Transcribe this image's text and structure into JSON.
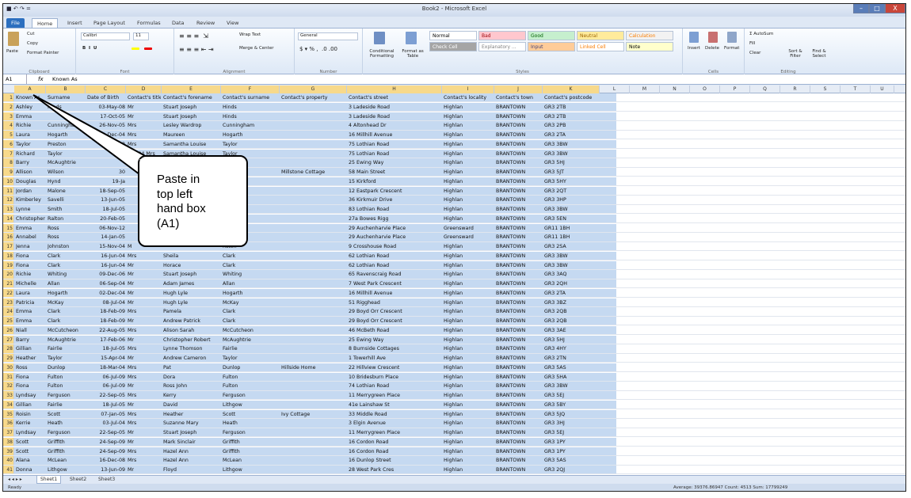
{
  "window": {
    "title": "Book2 - Microsoft Excel",
    "minimize": "–",
    "restore": "□",
    "close": "X"
  },
  "qat": "■ ↶ ↷ =",
  "tabs": [
    "File",
    "Home",
    "Insert",
    "Page Layout",
    "Formulas",
    "Data",
    "Review",
    "View"
  ],
  "ribbon": {
    "clipboard": {
      "paste": "Paste",
      "cut": "Cut",
      "copy": "Copy",
      "format_painter": "Format Painter",
      "label": "Clipboard"
    },
    "font": {
      "name": "Calibri",
      "size": "11",
      "label": "Font"
    },
    "alignment": {
      "wrap": "Wrap Text",
      "merge": "Merge & Center",
      "label": "Alignment"
    },
    "number": {
      "format": "General",
      "label": "Number"
    },
    "styles": {
      "conditional": "Conditional Formatting",
      "format_table": "Format as Table",
      "label": "Styles",
      "cells": [
        {
          "t": "Normal",
          "bg": "#ffffff",
          "c": "#000"
        },
        {
          "t": "Bad",
          "bg": "#ffc7ce",
          "c": "#9c0006"
        },
        {
          "t": "Good",
          "bg": "#c6efce",
          "c": "#006100"
        },
        {
          "t": "Neutral",
          "bg": "#ffeb9c",
          "c": "#9c6500"
        },
        {
          "t": "Calculation",
          "bg": "#f2f2f2",
          "c": "#fa7d00"
        },
        {
          "t": "Check Cell",
          "bg": "#a5a5a5",
          "c": "#ffffff"
        },
        {
          "t": "Explanatory ...",
          "bg": "#ffffff",
          "c": "#7f7f7f"
        },
        {
          "t": "Input",
          "bg": "#ffcc99",
          "c": "#3f3f76"
        },
        {
          "t": "Linked Cell",
          "bg": "#ffffff",
          "c": "#fa7d00"
        },
        {
          "t": "Note",
          "bg": "#ffffcc",
          "c": "#000"
        }
      ]
    },
    "cells": {
      "insert": "Insert",
      "delete": "Delete",
      "format": "Format",
      "label": "Cells"
    },
    "editing": {
      "autosum": "AutoSum",
      "fill": "Fill",
      "clear": "Clear",
      "sort": "Sort & Filter",
      "find": "Find & Select",
      "label": "Editing"
    }
  },
  "formula_bar": {
    "name_box": "A1",
    "fx": "fx",
    "value": "Known As"
  },
  "columns": [
    {
      "l": "A",
      "w": 40
    },
    {
      "l": "B",
      "w": 50
    },
    {
      "l": "C",
      "w": 51
    },
    {
      "l": "D",
      "w": 45
    },
    {
      "l": "E",
      "w": 75
    },
    {
      "l": "F",
      "w": 74
    },
    {
      "l": "G",
      "w": 85
    },
    {
      "l": "H",
      "w": 120
    },
    {
      "l": "I",
      "w": 66
    },
    {
      "l": "J",
      "w": 61
    },
    {
      "l": "K",
      "w": 72
    },
    {
      "l": "L",
      "w": 38
    },
    {
      "l": "M",
      "w": 38
    },
    {
      "l": "N",
      "w": 38
    },
    {
      "l": "O",
      "w": 38
    },
    {
      "l": "P",
      "w": 38
    },
    {
      "l": "Q",
      "w": 38
    },
    {
      "l": "R",
      "w": 38
    },
    {
      "l": "S",
      "w": 38
    },
    {
      "l": "T",
      "w": 38
    },
    {
      "l": "U",
      "w": 30
    }
  ],
  "rows": [
    [
      "Known As",
      "Surname",
      "Date of Birth",
      "Contact's title",
      "Contact's forename",
      "Contact's surname",
      "Contact's property",
      "Contact's street",
      "Contact's locality",
      "Contact's town",
      "Contact's postcode"
    ],
    [
      "Ashley",
      "Hinds",
      "03-May-08",
      "Mr",
      "Stuart Joseph",
      "Hinds",
      "",
      "3 Ladeside Road",
      "Highlan",
      "BRANTOWN",
      "GR3 2TB"
    ],
    [
      "Emma",
      "",
      "17-Oct-05",
      "Mr",
      "Stuart Joseph",
      "Hinds",
      "",
      "3 Ladeside Road",
      "Highlan",
      "BRANTOWN",
      "GR3 2TB"
    ],
    [
      "Richie",
      "Cunningham",
      "26-Nov-05",
      "Mrs",
      "Lesley Wardrop",
      "Cunningham",
      "",
      "4 Altonhead Dr",
      "Highlan",
      "BRANTOWN",
      "GR3 2PB"
    ],
    [
      "Laura",
      "Hogarth",
      "02-Dec-04",
      "Mrs",
      "Maureen",
      "Hogarth",
      "",
      "16 Millhill Avenue",
      "Highlan",
      "BRANTOWN",
      "GR3 2TA"
    ],
    [
      "Taylor",
      "Preston",
      "08-Apr-12",
      "Mrs",
      "Samantha Louise",
      "Taylor",
      "",
      "75 Lothian Road",
      "Highlan",
      "BRANTOWN",
      "GR3 3BW"
    ],
    [
      "Richard",
      "Taylor",
      "",
      "Feb-04 Mrs",
      "Samantha Louise",
      "Taylor",
      "",
      "75 Lothian Road",
      "Highlan",
      "BRANTOWN",
      "GR3 3BW"
    ],
    [
      "Barry",
      "McAughtrie",
      "",
      "",
      "",
      "aughtrie",
      "",
      "25 Ewing Way",
      "Highlan",
      "BRANTOWN",
      "GR3 5HJ"
    ],
    [
      "Allison",
      "Wilson",
      "30",
      "",
      "",
      "on",
      "Millstone Cottage",
      "58 Main Street",
      "Highlan",
      "BRANTOWN",
      "GR3 5JT"
    ],
    [
      "Douglas",
      "Hynd",
      "19-Ja",
      "",
      "",
      "",
      "",
      "15 Kirkford",
      "Highlan",
      "BRANTOWN",
      "GR3 5HY"
    ],
    [
      "Jordan",
      "Malone",
      "18-Sep-05",
      "",
      "",
      "n",
      "",
      "12 Eastpark Crescent",
      "Highlan",
      "BRANTOWN",
      "GR3 2QT"
    ],
    [
      "Kimberley",
      "Savelli",
      "13-Jun-05",
      "",
      "",
      "lli",
      "",
      "36 Kirkmuir Drive",
      "Highlan",
      "BRANTOWN",
      "GR3 3HP"
    ],
    [
      "Lynne",
      "Smith",
      "18-Jul-05",
      "",
      "",
      "lli",
      "",
      "83 Lothian Road",
      "Highlan",
      "BRANTOWN",
      "GR3 3BW"
    ],
    [
      "Christopher",
      "Ralton",
      "20-Feb-05",
      "",
      "",
      "n",
      "",
      "27a Bowes Rigg",
      "Highlan",
      "BRANTOWN",
      "GR3 5EN"
    ],
    [
      "Emma",
      "Ross",
      "06-Nov-12",
      "",
      "",
      "",
      "",
      "29 Auchenharvie Place",
      "Greensward",
      "BRANTOWN",
      "GR11 1BH"
    ],
    [
      "Annabel",
      "Ross",
      "14-Jan-05",
      "",
      "",
      "",
      "",
      "29 Auchenharvie Place",
      "Greensward",
      "BRANTOWN",
      "GR11 1BH"
    ],
    [
      "Jenna",
      "Johnston",
      "15-Nov-04",
      "M",
      "",
      "nston",
      "",
      "9 Crosshouse Road",
      "Highlan",
      "BRANTOWN",
      "GR3 2SA"
    ],
    [
      "Fiona",
      "Clark",
      "16-Jun-04",
      "Mrs",
      "Sheila",
      "Clark",
      "",
      "62 Lothian Road",
      "Highlan",
      "BRANTOWN",
      "GR3 3BW"
    ],
    [
      "Fiona",
      "Clark",
      "16-Jun-04",
      "Mr",
      "Horace",
      "Clark",
      "",
      "62 Lothian Road",
      "Highlan",
      "BRANTOWN",
      "GR3 3BW"
    ],
    [
      "Richie",
      "Whiting",
      "09-Dec-06",
      "Mr",
      "Stuart Joseph",
      "Whiting",
      "",
      "65 Ravenscraig Road",
      "Highlan",
      "BRANTOWN",
      "GR3 3AQ"
    ],
    [
      "Michelle",
      "Allan",
      "06-Sep-04",
      "Mr",
      "Adam James",
      "Allan",
      "",
      "7 West Park Crescent",
      "Highlan",
      "BRANTOWN",
      "GR3 2QH"
    ],
    [
      "Laura",
      "Hogarth",
      "02-Dec-04",
      "Mr",
      "Hugh Lyle",
      "Hogarth",
      "",
      "16 Millhill Avenue",
      "Highlan",
      "BRANTOWN",
      "GR3 2TA"
    ],
    [
      "Patricia",
      "McKay",
      "08-Jul-04",
      "Mr",
      "Hugh Lyle",
      "McKay",
      "",
      "51 Rigghead",
      "Highlan",
      "BRANTOWN",
      "GR3 3BZ"
    ],
    [
      "Emma",
      "Clark",
      "18-Feb-09",
      "Mrs",
      "Pamela",
      "Clark",
      "",
      "29 Boyd Orr Crescent",
      "Highlan",
      "BRANTOWN",
      "GR3 2QB"
    ],
    [
      "Emma",
      "Clark",
      "18-Feb-09",
      "Mr",
      "Andrew Patrick",
      "Clark",
      "",
      "29 Boyd Orr Crescent",
      "Highlan",
      "BRANTOWN",
      "GR3 2QB"
    ],
    [
      "Niall",
      "McCutcheon",
      "22-Aug-05",
      "Mrs",
      "Alison Sarah",
      "McCutcheon",
      "",
      "46 McBeth Road",
      "Highlan",
      "BRANTOWN",
      "GR3 3AE"
    ],
    [
      "Barry",
      "McAughtrie",
      "17-Feb-06",
      "Mr",
      "Christopher Robert",
      "McAughtrie",
      "",
      "25 Ewing Way",
      "Highlan",
      "BRANTOWN",
      "GR3 5HJ"
    ],
    [
      "Gillian",
      "Fairlie",
      "18-Jul-05",
      "Mrs",
      "Lynne Thomson",
      "Fairlie",
      "",
      "8 Burnside Cottages",
      "Highlan",
      "BRANTOWN",
      "GR3 4HY"
    ],
    [
      "Heather",
      "Taylor",
      "15-Apr-04",
      "Mr",
      "Andrew Cameron",
      "Taylor",
      "",
      "1 Towerhill Ave",
      "Highlan",
      "BRANTOWN",
      "GR3 2TN"
    ],
    [
      "Ross",
      "Dunlop",
      "18-Mar-04",
      "Mrs",
      "Pat",
      "Dunlop",
      "Hillside Home",
      "22 Hillview Crescent",
      "Highlan",
      "BRANTOWN",
      "GR3 5AS"
    ],
    [
      "Fiona",
      "Fulton",
      "06-Jul-09",
      "Mrs",
      "Dora",
      "Fulton",
      "",
      "10 Bridesburn Place",
      "Highlan",
      "BRANTOWN",
      "GR3 5HA"
    ],
    [
      "Fiona",
      "Fulton",
      "06-Jul-09",
      "Mr",
      "Ross John",
      "Fulton",
      "",
      "74 Lothian Road",
      "Highlan",
      "BRANTOWN",
      "GR3 3BW"
    ],
    [
      "Lyndsay",
      "Ferguson",
      "22-Sep-05",
      "Mrs",
      "Kerry",
      "Ferguson",
      "",
      "11 Merrygreen Place",
      "Highlan",
      "BRANTOWN",
      "GR3 5EJ"
    ],
    [
      "Gillian",
      "Fairlie",
      "18-Jul-05",
      "Mr",
      "David",
      "Lithgow",
      "",
      "41e Lainshaw St",
      "Highlan",
      "BRANTOWN",
      "GR3 5BY"
    ],
    [
      "Roisin",
      "Scott",
      "07-Jan-05",
      "Mrs",
      "Heather",
      "Scott",
      "Ivy Cottage",
      "33 Middle Road",
      "Highlan",
      "BRANTOWN",
      "GR3 5JQ"
    ],
    [
      "Kerrie",
      "Heath",
      "03-Jul-04",
      "Mrs",
      "Suzanne Mary",
      "Heath",
      "",
      "3 Elgin Avenue",
      "Highlan",
      "BRANTOWN",
      "GR3 3HJ"
    ],
    [
      "Lyndsay",
      "Ferguson",
      "22-Sep-05",
      "Mr",
      "Stuart Joseph",
      "Ferguson",
      "",
      "11 Merrygreen Place",
      "Highlan",
      "BRANTOWN",
      "GR3 5EJ"
    ],
    [
      "Scott",
      "Griffith",
      "24-Sep-09",
      "Mr",
      "Mark Sinclair",
      "Griffith",
      "",
      "16 Cordon Road",
      "Highlan",
      "BRANTOWN",
      "GR3 1PY"
    ],
    [
      "Scott",
      "Griffith",
      "24-Sep-09",
      "Mrs",
      "Hazel Ann",
      "Griffith",
      "",
      "16 Cordon Road",
      "Highlan",
      "BRANTOWN",
      "GR3 1PY"
    ],
    [
      "Alana",
      "McLean",
      "16-Dec-08",
      "Mrs",
      "Hazel Ann",
      "McLean",
      "",
      "16 Dunlop Street",
      "Highlan",
      "BRANTOWN",
      "GR3 5AS"
    ],
    [
      "Donna",
      "Lithgow",
      "13-Jun-09",
      "Mr",
      "Floyd",
      "Lithgow",
      "",
      "28 West Park Cres",
      "Highlan",
      "BRANTOWN",
      "GR3 2QJ"
    ]
  ],
  "sheets": [
    "Sheet1",
    "Sheet2",
    "Sheet3"
  ],
  "status": {
    "ready": "Ready",
    "summary": "Average: 39376.86947    Count: 4513    Sum: 17799249"
  },
  "callout": "Paste in\ntop left\nhand box\n(A1)"
}
